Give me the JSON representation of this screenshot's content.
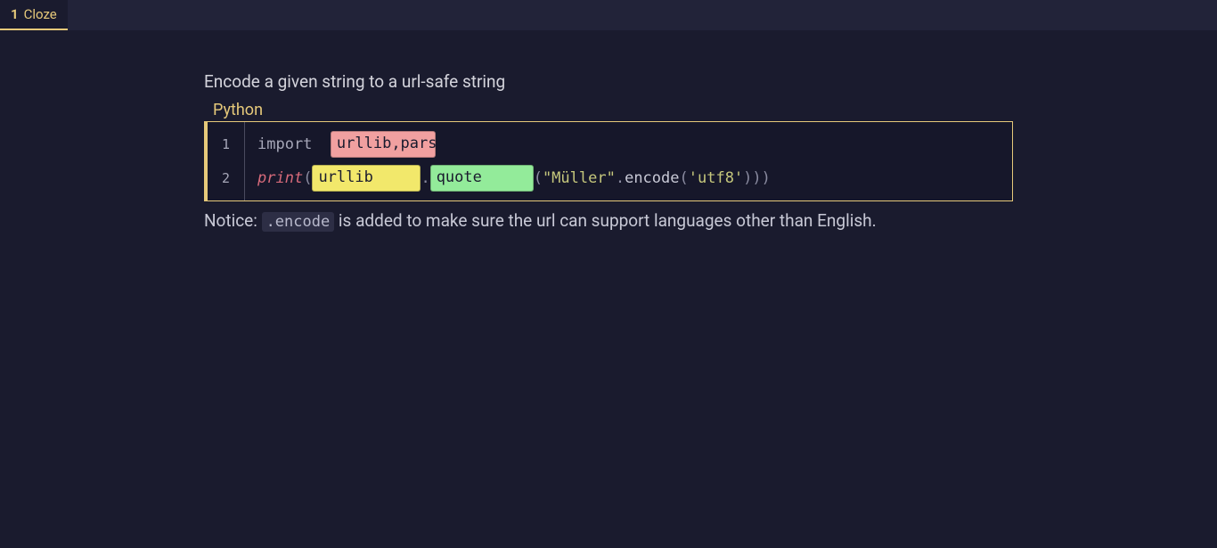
{
  "tab": {
    "number": "1",
    "label": "Cloze"
  },
  "prompt": "Encode a given string to a url-safe string",
  "lang": "Python",
  "gutter": [
    "1",
    "2"
  ],
  "code": {
    "l1": {
      "kw": "import ",
      "cloze1": "urllib,pars"
    },
    "l2": {
      "print": "print",
      "open1": "(",
      "cloze_yellow": "urllib",
      "dot": ".",
      "cloze_green": "quote",
      "open2": "(",
      "str1": "\"Müller\"",
      "enc_dot": ".",
      "enc": "encode",
      "open3": "(",
      "str2": "'utf8'",
      "close": ")))"
    }
  },
  "notice": {
    "lead": "Notice: ",
    "code": ".encode",
    "rest": " is added to make sure the url can support languages other than English."
  }
}
